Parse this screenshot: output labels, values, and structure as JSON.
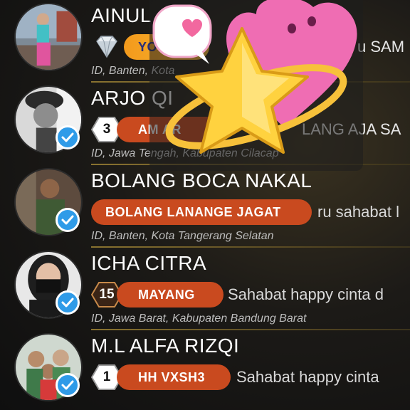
{
  "users": [
    {
      "name": "AINUL",
      "badge_type": "diamond",
      "tag": "YO",
      "message": "u SAM",
      "location": "ID, Banten, Kota"
    },
    {
      "name": "ARJO QI",
      "level": "3",
      "tag": "AM  AR",
      "message": "LANG AJA SA",
      "location": "ID, Jawa Tengah, Kabupaten Cilacap"
    },
    {
      "name": "BOLANG BOCA  NAKAL",
      "tag": "BOLANG LANANGE JAGAT",
      "message": "ru sahabat l",
      "location": "ID, Banten, Kota Tangerang Selatan"
    },
    {
      "name": "ICHA CITRA",
      "level": "15",
      "tag": "MAYANG",
      "message": "Sahabat happy cinta d",
      "location": "ID, Jawa Barat, Kabupaten Bandung Barat"
    },
    {
      "name": "M.L ALFA RIZQI",
      "level": "1",
      "tag": "HH  VXSH3",
      "message": "Sahabat happy cinta",
      "location": ""
    }
  ],
  "icons": {
    "verified": "verified-check-icon",
    "diamond": "diamond-icon",
    "sticker": "heart-star-sticker"
  },
  "colors": {
    "tag_bg": "#c94a1f",
    "divider": "#8a7330",
    "verified": "#2f9be8"
  }
}
